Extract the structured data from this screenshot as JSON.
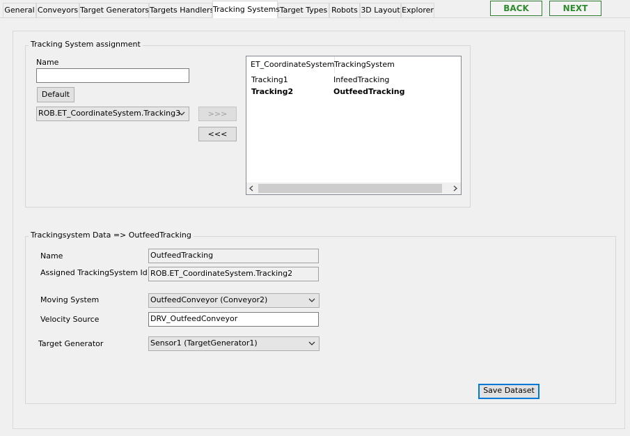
{
  "tabs": [
    {
      "label": "General"
    },
    {
      "label": "Conveyors"
    },
    {
      "label": "Target Generators"
    },
    {
      "label": "Targets Handlers"
    },
    {
      "label": "Tracking Systems"
    },
    {
      "label": "Target Types"
    },
    {
      "label": "Robots"
    },
    {
      "label": "3D Layout"
    },
    {
      "label": "Explorer"
    }
  ],
  "active_tab": "Tracking Systems",
  "nav": {
    "back": "BACK",
    "next": "NEXT",
    "color": "#2e8b2e"
  },
  "assignment": {
    "title": "Tracking System assignment",
    "name_label": "Name",
    "name_value": "",
    "default_button": "Default",
    "coordinate_select": "ROB.ET_CoordinateSystem.Tracking3",
    "add_button": ">>>",
    "remove_button": "<<<",
    "list": {
      "columns": [
        "ET_CoordinateSystem",
        "TrackingSystem"
      ],
      "rows": [
        {
          "coord": "Tracking1",
          "system": "InfeedTracking",
          "bold": false
        },
        {
          "coord": "Tracking2",
          "system": "OutfeedTracking",
          "bold": true
        }
      ]
    }
  },
  "data": {
    "title": "Trackingsystem Data => OutfeedTracking",
    "name_label": "Name",
    "name_value": "OutfeedTracking",
    "assigned_label": "Assigned TrackingSystem Id",
    "assigned_value": "ROB.ET_CoordinateSystem.Tracking2",
    "moving_label": "Moving System",
    "moving_value": "OutfeedConveyor (Conveyor2)",
    "velocity_label": "Velocity Source",
    "velocity_value": "DRV_OutfeedConveyor",
    "generator_label": "Target Generator",
    "generator_value": "Sensor1 (TargetGenerator1)",
    "save_button": "Save Dataset"
  }
}
